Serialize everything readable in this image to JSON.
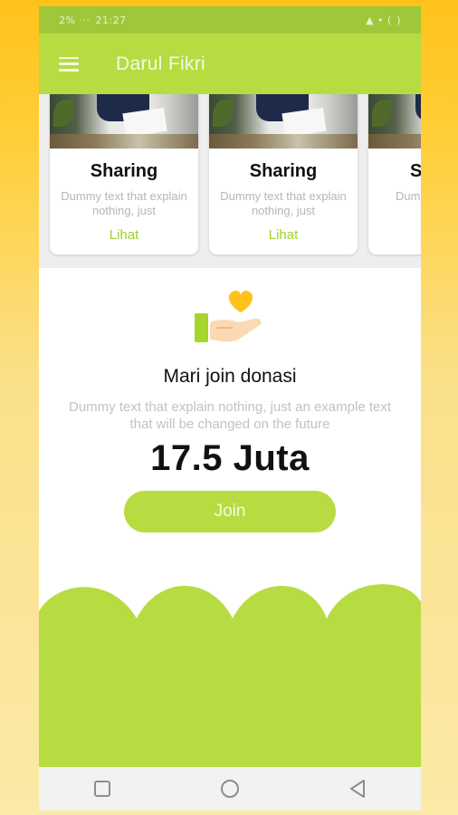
{
  "status_bar": {
    "time": "21:27",
    "left_text": "2%  ···",
    "right_text": "▲ • (  )"
  },
  "app_bar": {
    "title": "Darul Fikri",
    "menu_icon": "hamburger-menu-icon"
  },
  "cards": [
    {
      "title": "Sharing",
      "description": "Dummy text that explain nothing, just",
      "link": "Lihat"
    },
    {
      "title": "Sharing",
      "description": "Dummy text that explain nothing, just",
      "link": "Lihat"
    },
    {
      "title": "S",
      "description": "Dumr explain",
      "link": ""
    }
  ],
  "donation": {
    "icon": "heart-hand-icon",
    "title": "Mari join donasi",
    "description": "Dummy text that explain nothing, just an example text that will be changed on the future",
    "amount": "17.5 Juta",
    "button": "Join"
  },
  "nav": {
    "recents_icon": "square-icon",
    "home_icon": "circle-icon",
    "back_icon": "triangle-back-icon"
  },
  "colors": {
    "accent": "#b6dc41",
    "link": "#a3cf2a",
    "status_bar": "#9fc73a"
  }
}
